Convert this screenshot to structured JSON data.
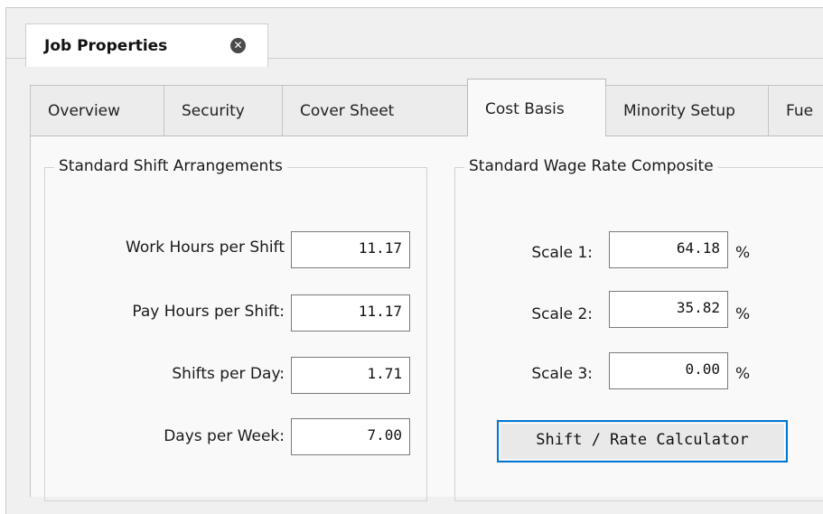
{
  "document_tab": {
    "title": "Job Properties",
    "close_icon": "close-icon"
  },
  "tabs": [
    {
      "label": "Overview",
      "active": false
    },
    {
      "label": "Security",
      "active": false
    },
    {
      "label": "Cover Sheet",
      "active": false
    },
    {
      "label": "Cost Basis",
      "active": true
    },
    {
      "label": "Minority Setup",
      "active": false
    },
    {
      "label": "Fue",
      "active": false
    }
  ],
  "shift_group": {
    "title": "Standard Shift Arrangements",
    "fields": [
      {
        "label": "Work Hours per Shift",
        "value": "11.17"
      },
      {
        "label": "Pay Hours per Shift:",
        "value": "11.17"
      },
      {
        "label": "Shifts per Day:",
        "value": "1.71"
      },
      {
        "label": "Days per Week:",
        "value": "7.00"
      }
    ]
  },
  "wage_group": {
    "title": "Standard Wage Rate Composite",
    "fields": [
      {
        "label": "Scale 1:",
        "value": "64.18",
        "unit": "%"
      },
      {
        "label": "Scale 2:",
        "value": "35.82",
        "unit": "%"
      },
      {
        "label": "Scale 3:",
        "value": "0.00",
        "unit": "%"
      }
    ],
    "button_label": "Shift / Rate Calculator"
  },
  "colors": {
    "accent": "#0078d7",
    "panel": "#f9f9f9",
    "chrome": "#f0f0f0"
  }
}
